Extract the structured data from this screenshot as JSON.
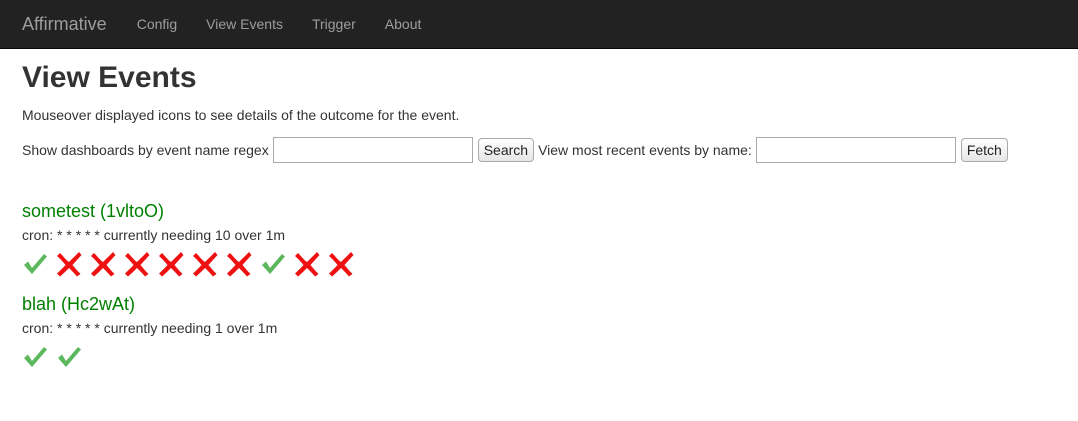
{
  "nav": {
    "brand": "Affirmative",
    "items": [
      {
        "label": "Config"
      },
      {
        "label": "View Events"
      },
      {
        "label": "Trigger"
      },
      {
        "label": "About"
      }
    ]
  },
  "page": {
    "title": "View Events",
    "intro": "Mouseover displayed icons to see details of the outcome for the event."
  },
  "controls": {
    "regex_label": "Show dashboards by event name regex",
    "regex_value": "",
    "search_label": "Search",
    "recent_label": "View most recent events by name:",
    "recent_value": "",
    "fetch_label": "Fetch"
  },
  "colors": {
    "success": "#5cb85c",
    "failure": "#ee1111",
    "title": "#008000"
  },
  "events": [
    {
      "title": "sometest (1vltoO)",
      "cron": "cron: * * * * * currently needing 10 over 1m",
      "outcomes": [
        "success",
        "failure",
        "failure",
        "failure",
        "failure",
        "failure",
        "failure",
        "success",
        "failure",
        "failure"
      ]
    },
    {
      "title": "blah (Hc2wAt)",
      "cron": "cron: * * * * * currently needing 1 over 1m",
      "outcomes": [
        "success",
        "success"
      ]
    }
  ]
}
